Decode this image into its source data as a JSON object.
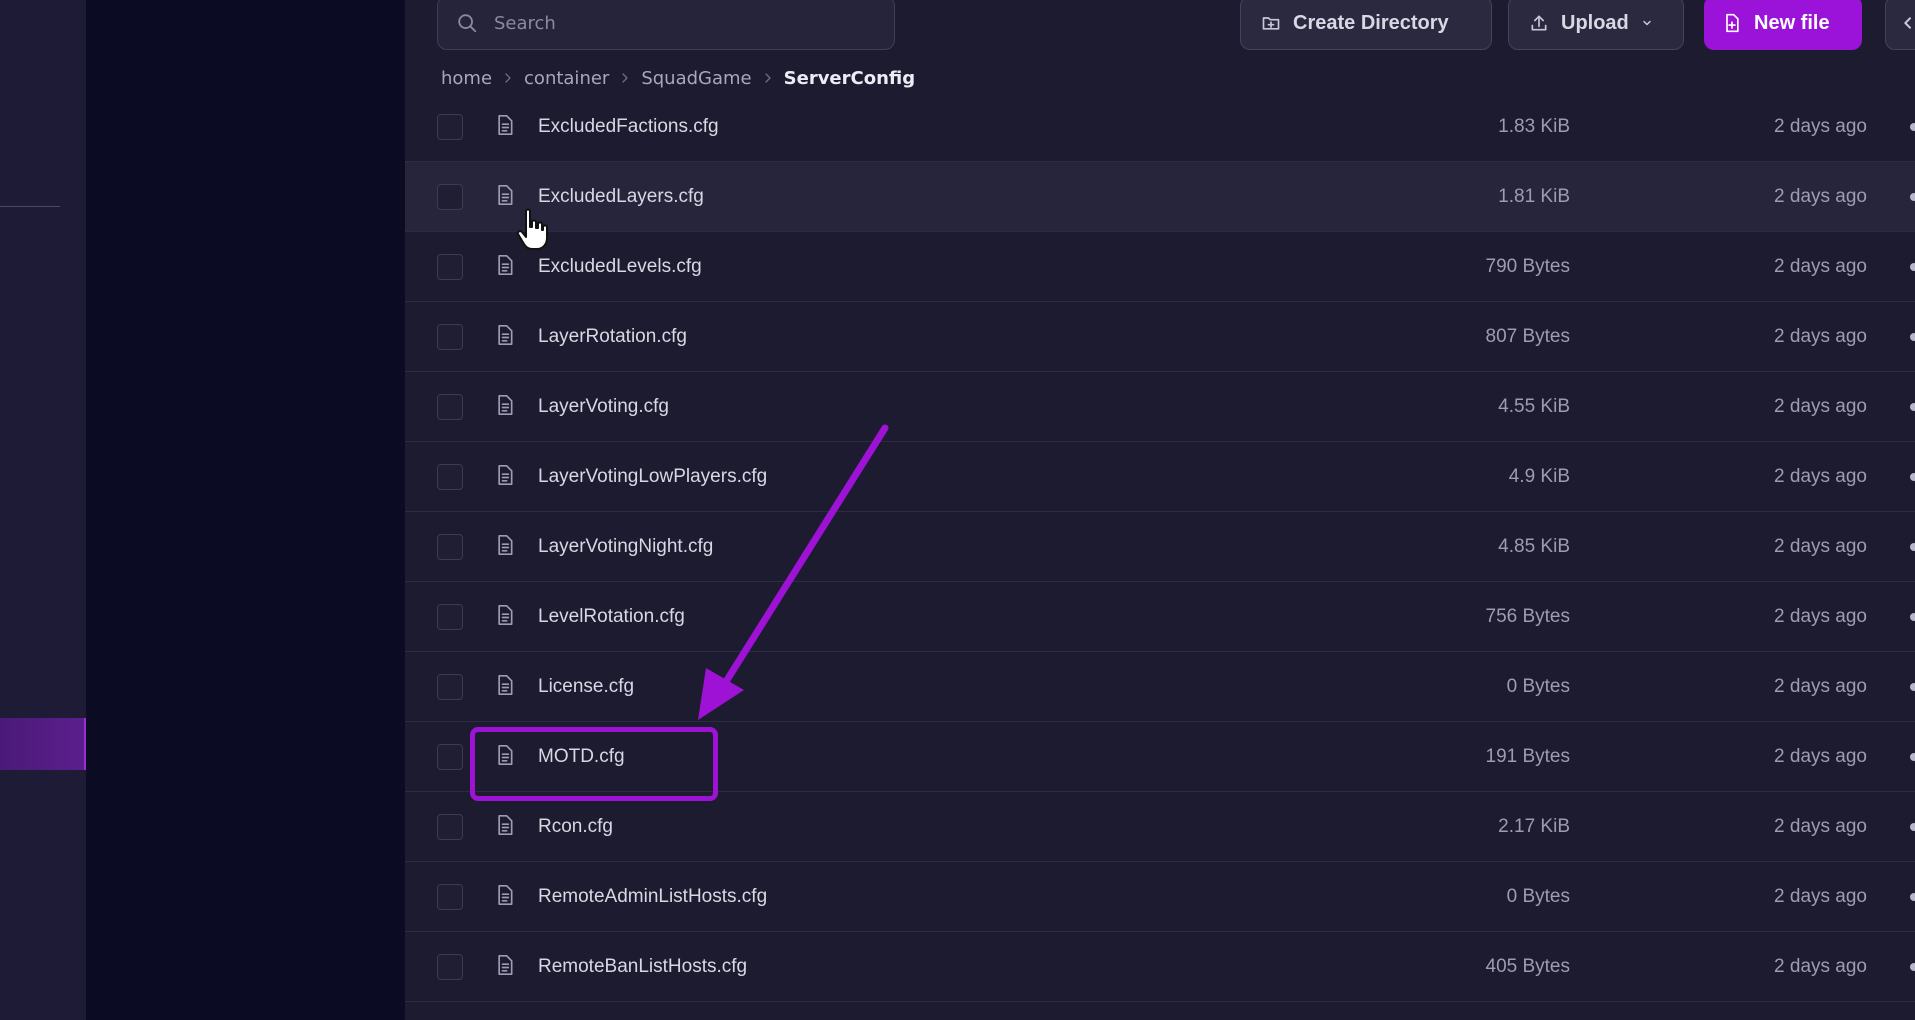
{
  "toolbar": {
    "search_placeholder": "Search",
    "create_directory_label": "Create Directory",
    "upload_label": "Upload",
    "new_file_label": "New file"
  },
  "breadcrumb": {
    "items": [
      "home",
      "container",
      "SquadGame"
    ],
    "current": "ServerConfig"
  },
  "files": [
    {
      "name": "ExcludedFactions.cfg",
      "size": "1.83 KiB",
      "modified": "2 days ago"
    },
    {
      "name": "ExcludedLayers.cfg",
      "size": "1.81 KiB",
      "modified": "2 days ago"
    },
    {
      "name": "ExcludedLevels.cfg",
      "size": "790 Bytes",
      "modified": "2 days ago"
    },
    {
      "name": "LayerRotation.cfg",
      "size": "807 Bytes",
      "modified": "2 days ago"
    },
    {
      "name": "LayerVoting.cfg",
      "size": "4.55 KiB",
      "modified": "2 days ago"
    },
    {
      "name": "LayerVotingLowPlayers.cfg",
      "size": "4.9 KiB",
      "modified": "2 days ago"
    },
    {
      "name": "LayerVotingNight.cfg",
      "size": "4.85 KiB",
      "modified": "2 days ago"
    },
    {
      "name": "LevelRotation.cfg",
      "size": "756 Bytes",
      "modified": "2 days ago"
    },
    {
      "name": "License.cfg",
      "size": "0 Bytes",
      "modified": "2 days ago"
    },
    {
      "name": "MOTD.cfg",
      "size": "191 Bytes",
      "modified": "2 days ago"
    },
    {
      "name": "Rcon.cfg",
      "size": "2.17 KiB",
      "modified": "2 days ago"
    },
    {
      "name": "RemoteAdminListHosts.cfg",
      "size": "0 Bytes",
      "modified": "2 days ago"
    },
    {
      "name": "RemoteBanListHosts.cfg",
      "size": "405 Bytes",
      "modified": "2 days ago"
    }
  ],
  "icons": {
    "search": "search-icon",
    "create_directory": "folder-plus-icon",
    "upload": "upload-icon",
    "upload_dropdown": "chevron-down-icon",
    "new_file": "file-plus-icon",
    "more": "chevron-left-icon",
    "breadcrumb_separator": "chevron-right-icon",
    "file": "file-text-icon",
    "row_menu": "more-horizontal-icon",
    "cursor": "hand-pointer-icon"
  },
  "colors": {
    "accent": "#9b13d9",
    "annotation": "#9d12d4",
    "sidebar_active": "#5b1f8c",
    "background": "#1c1b30"
  },
  "state": {
    "hovered_file": "ExcludedLayers.cfg",
    "highlighted_file": "MOTD.cfg"
  }
}
